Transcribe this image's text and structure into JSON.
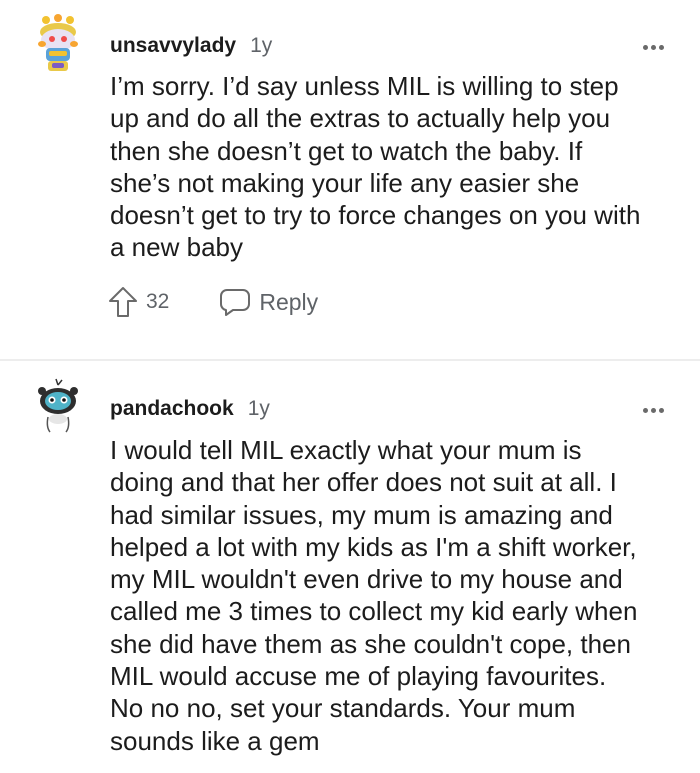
{
  "comments": [
    {
      "author": "unsavvylady",
      "age": "1y",
      "body": "I’m sorry. I’d say unless MIL is willing to step\nup and do all the extras to actually help you\nthen she doesn’t get to watch the baby. If\nshe’s not making your life any easier she\ndoesn’t get to try to force changes on you with\na new baby",
      "upvotes": "32",
      "reply_label": "Reply"
    },
    {
      "author": "pandachook",
      "age": "1y",
      "body": "I would tell MIL exactly what your mum is\ndoing and that her offer does not suit at all. I\nhad similar issues, my mum is amazing and\nhelped a lot with my kids as I'm a shift worker,\nmy MIL wouldn't even drive to my house and\ncalled me 3 times to collect my kid early when\nshe did have them as she couldn't cope, then\nMIL would accuse me of playing favourites.\nNo no no, set your standards. Your mum\nsounds like a gem"
    }
  ],
  "icons": {
    "overflow": "more-horizontal-icon",
    "upvote": "upvote-arrow-icon",
    "reply": "speech-bubble-icon"
  },
  "colors": {
    "text": "#1c1c1c",
    "meta": "#5f6368",
    "divider": "#ededed"
  }
}
